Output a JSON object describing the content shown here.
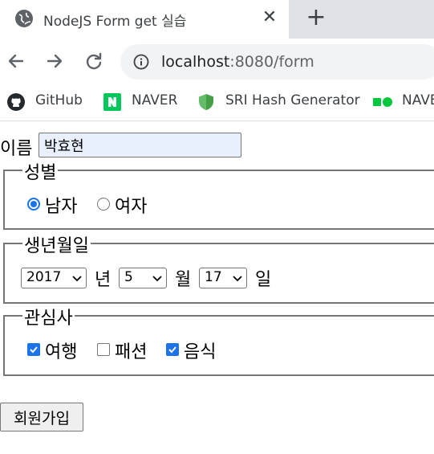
{
  "browser": {
    "tab": {
      "title": "NodeJS Form get 실습",
      "favicon": "globe-icon",
      "close_glyph": "✕"
    },
    "new_tab_glyph": "+",
    "toolbar": {
      "back": "arrow-left-icon",
      "forward": "arrow-right-icon",
      "reload": "reload-icon",
      "info": "info-icon"
    },
    "url": {
      "host": "localhost",
      "path": ":8080/form"
    },
    "bookmarks": [
      {
        "label": "GitHub",
        "icon": "github-icon"
      },
      {
        "label": "NAVER",
        "icon": "naver-icon",
        "color": "#03c75a"
      },
      {
        "label": "SRI Hash Generator",
        "icon": "shield-icon",
        "color": "#66bb6a"
      },
      {
        "label": "NAVE",
        "icon": "naver-dots-icon",
        "color": "#00c73c"
      }
    ],
    "accent": "#1a73e8"
  },
  "form": {
    "name": {
      "label": "이름",
      "value": "박효현"
    },
    "gender": {
      "legend": "성별",
      "options": [
        {
          "label": "남자",
          "checked": true
        },
        {
          "label": "여자",
          "checked": false
        }
      ]
    },
    "birth": {
      "legend": "생년월일",
      "year": {
        "value": "2017",
        "unit": "년"
      },
      "month": {
        "value": "5",
        "unit": "월"
      },
      "day": {
        "value": "17",
        "unit": "일"
      }
    },
    "interests": {
      "legend": "관심사",
      "options": [
        {
          "label": "여행",
          "checked": true
        },
        {
          "label": "패션",
          "checked": false
        },
        {
          "label": "음식",
          "checked": true
        }
      ]
    },
    "submit_label": "회원가입"
  }
}
